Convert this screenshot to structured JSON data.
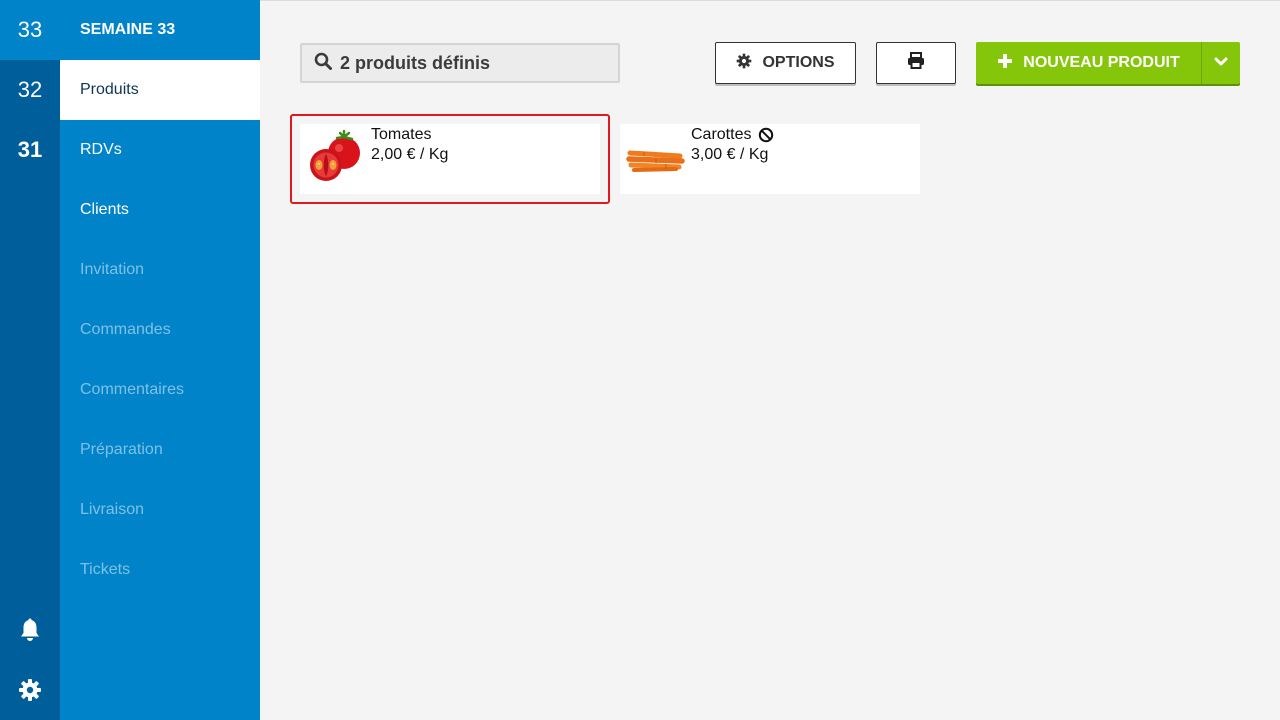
{
  "weeks": [
    {
      "number": "33",
      "active": true
    },
    {
      "number": "32",
      "active": false
    },
    {
      "number": "31",
      "active": false,
      "bold": true
    }
  ],
  "rail_icons": [
    "bell-icon",
    "gear-icon"
  ],
  "nav": {
    "title": "SEMAINE 33",
    "items": [
      {
        "label": "Produits",
        "state": "active"
      },
      {
        "label": "RDVs",
        "state": "enabled"
      },
      {
        "label": "Clients",
        "state": "enabled"
      },
      {
        "label": "Invitation",
        "state": "disabled"
      },
      {
        "label": "Commandes",
        "state": "disabled"
      },
      {
        "label": "Commentaires",
        "state": "disabled"
      },
      {
        "label": "Préparation",
        "state": "disabled"
      },
      {
        "label": "Livraison",
        "state": "disabled"
      },
      {
        "label": "Tickets",
        "state": "disabled"
      }
    ]
  },
  "toolbar": {
    "search_text": "2 produits définis",
    "search_icon": "search-icon",
    "options_label": "OPTIONS",
    "options_icon": "gear-icon",
    "print_icon": "print-icon",
    "new_product_label": "NOUVEAU PRODUIT",
    "new_product_icon": "plus-icon",
    "dropdown_icon": "chevron-down-icon"
  },
  "products": [
    {
      "name": "Tomates",
      "price": "2,00 € / Kg",
      "image": "tomato-image",
      "selected": true,
      "unavailable": false
    },
    {
      "name": "Carottes",
      "price": "3,00 € / Kg",
      "image": "carrot-image",
      "selected": false,
      "unavailable": true
    }
  ],
  "colors": {
    "rail": "#005e9a",
    "nav": "#0083c9",
    "accent_green": "#86c60a",
    "selection_red": "#e0191f"
  }
}
